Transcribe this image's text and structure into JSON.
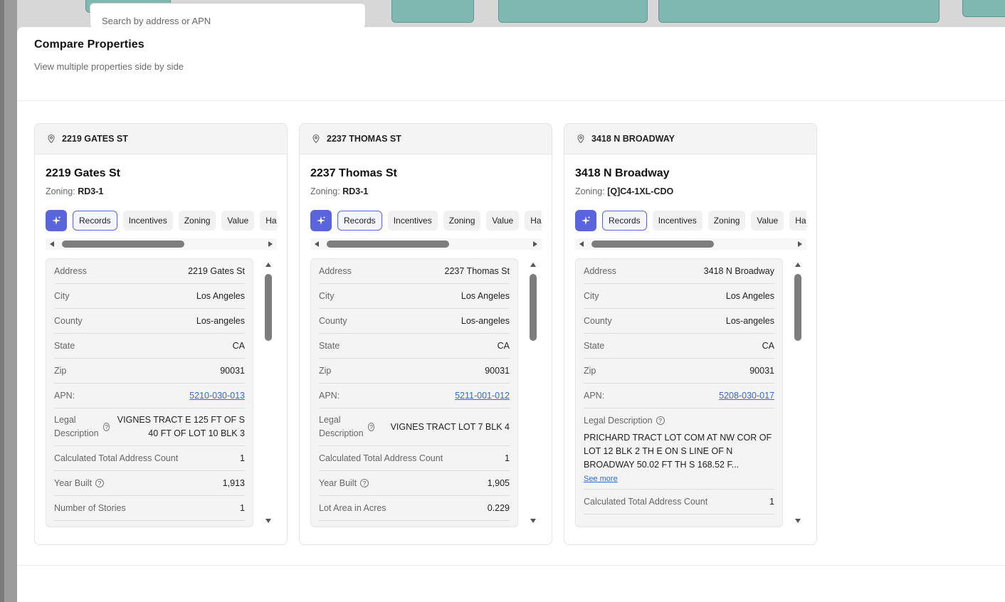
{
  "background": {
    "search_placeholder": "Search by address or APN"
  },
  "modal": {
    "title": "Compare Properties",
    "subtitle": "View multiple properties side by side"
  },
  "colors": {
    "accent": "#5a64dc",
    "link": "#2c6bd8",
    "map_parcel": "#7fb7b1"
  },
  "cards": [
    {
      "header": "2219 GATES ST",
      "title": "2219 Gates St",
      "zoning_label": "Zoning:",
      "zoning": "RD3-1",
      "tabs": [
        "Records",
        "Incentives",
        "Zoning",
        "Value",
        "Haza"
      ],
      "rows": [
        {
          "label": "Address",
          "value": "2219 Gates St"
        },
        {
          "label": "City",
          "value": "Los Angeles"
        },
        {
          "label": "County",
          "value": "Los-angeles"
        },
        {
          "label": "State",
          "value": "CA"
        },
        {
          "label": "Zip",
          "value": "90031"
        },
        {
          "label": "APN:",
          "value": "5210-030-013"
        },
        {
          "label": "Legal Description",
          "value": "VIGNES TRACT E 125 FT OF S 40 FT OF LOT 10 BLK 3"
        },
        {
          "label": "Calculated Total Address Count",
          "value": "1"
        },
        {
          "label": "Year Built",
          "value": "1,913"
        },
        {
          "label": "Number of Stories",
          "value": "1"
        }
      ]
    },
    {
      "header": "2237 THOMAS ST",
      "title": "2237 Thomas St",
      "zoning_label": "Zoning:",
      "zoning": "RD3-1",
      "tabs": [
        "Records",
        "Incentives",
        "Zoning",
        "Value",
        "Haza"
      ],
      "rows": [
        {
          "label": "Address",
          "value": "2237 Thomas St"
        },
        {
          "label": "City",
          "value": "Los Angeles"
        },
        {
          "label": "County",
          "value": "Los-angeles"
        },
        {
          "label": "State",
          "value": "CA"
        },
        {
          "label": "Zip",
          "value": "90031"
        },
        {
          "label": "APN:",
          "value": "5211-001-012"
        },
        {
          "label": "Legal Description",
          "value": "VIGNES TRACT LOT 7 BLK 4"
        },
        {
          "label": "Calculated Total Address Count",
          "value": "1"
        },
        {
          "label": "Year Built",
          "value": "1,905"
        },
        {
          "label": "Lot Area in Acres",
          "value": "0.229"
        }
      ]
    },
    {
      "header": "3418 N BROADWAY",
      "title": "3418 N Broadway",
      "zoning_label": "Zoning:",
      "zoning": "[Q]C4-1XL-CDO",
      "tabs": [
        "Records",
        "Incentives",
        "Zoning",
        "Value",
        "Haza"
      ],
      "rows": [
        {
          "label": "Address",
          "value": "3418 N Broadway"
        },
        {
          "label": "City",
          "value": "Los Angeles"
        },
        {
          "label": "County",
          "value": "Los-angeles"
        },
        {
          "label": "State",
          "value": "CA"
        },
        {
          "label": "Zip",
          "value": "90031"
        },
        {
          "label": "APN:",
          "value": "5208-030-017"
        },
        {
          "label": "Legal Description",
          "value": "PRICHARD TRACT LOT COM AT NW COR OF LOT 12 BLK 2 TH E ON S LINE OF N BROADWAY 50.02 FT TH S 168.52 F..."
        },
        {
          "label": "Calculated Total Address Count",
          "value": "1"
        }
      ],
      "see_more": "See more"
    }
  ]
}
